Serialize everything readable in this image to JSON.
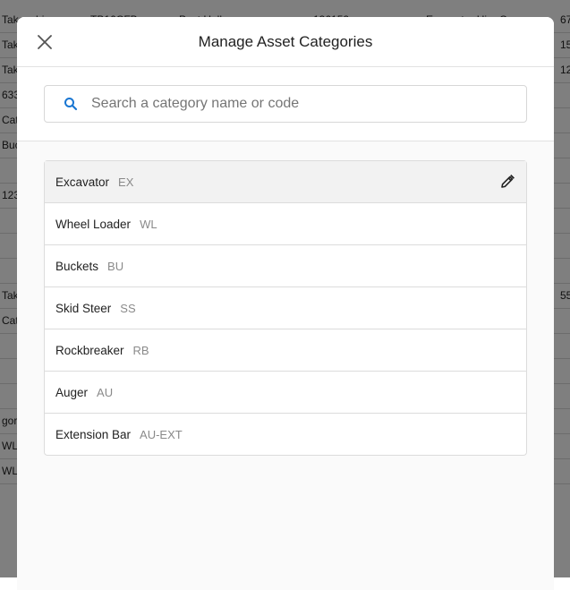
{
  "background": {
    "rows": [
      {
        "cells": [
          "Takeuchi",
          "TB16CFB",
          "Post Holl",
          "136152",
          "Excavator Hire Co",
          "67"
        ]
      },
      {
        "cells": [
          "Tak",
          "",
          "",
          "",
          "",
          "15"
        ]
      },
      {
        "cells": [
          "Tak",
          "",
          "",
          "",
          "",
          "12"
        ]
      },
      {
        "cells": [
          "633",
          "",
          "",
          "",
          "",
          ""
        ]
      },
      {
        "cells": [
          "Cat",
          "",
          "",
          "",
          "",
          ""
        ]
      },
      {
        "cells": [
          "Buc",
          "",
          "",
          "",
          "",
          ""
        ]
      },
      {
        "cells": [
          "",
          "",
          "",
          "",
          "",
          ""
        ]
      },
      {
        "cells": [
          "123",
          "",
          "",
          "",
          "",
          ""
        ]
      },
      {
        "cells": [
          "",
          "",
          "",
          "",
          "",
          ""
        ]
      },
      {
        "cells": [
          "",
          "",
          "",
          "",
          "",
          ""
        ]
      },
      {
        "cells": [
          "",
          "",
          "",
          "",
          "",
          ""
        ]
      },
      {
        "cells": [
          "Tak",
          "",
          "",
          "",
          "",
          "55"
        ]
      },
      {
        "cells": [
          "Cat",
          "",
          "",
          "",
          "",
          ""
        ]
      },
      {
        "cells": [
          "",
          "",
          "",
          "",
          "",
          ""
        ]
      },
      {
        "cells": [
          "",
          "",
          "",
          "",
          "",
          ""
        ]
      },
      {
        "cells": [
          "",
          "",
          "",
          "",
          "",
          ""
        ]
      },
      {
        "cells": [
          "gor",
          "",
          "",
          "",
          "",
          ""
        ]
      },
      {
        "cells": [
          "WL,",
          "",
          "",
          "",
          "",
          ""
        ]
      },
      {
        "cells": [
          "WL",
          "",
          "",
          "",
          "",
          ""
        ]
      }
    ]
  },
  "modal": {
    "title": "Manage Asset Categories",
    "close_icon": "close-icon",
    "search": {
      "placeholder": "Search a category name or code",
      "value": "",
      "icon": "search-icon",
      "icon_color": "#1976d2"
    },
    "categories": [
      {
        "name": "Excavator",
        "code": "EX",
        "selected": true
      },
      {
        "name": "Wheel Loader",
        "code": "WL",
        "selected": false
      },
      {
        "name": "Buckets",
        "code": "BU",
        "selected": false
      },
      {
        "name": "Skid Steer",
        "code": "SS",
        "selected": false
      },
      {
        "name": "Rockbreaker",
        "code": "RB",
        "selected": false
      },
      {
        "name": "Auger",
        "code": "AU",
        "selected": false
      },
      {
        "name": "Extension Bar",
        "code": "AU-EXT",
        "selected": false
      }
    ],
    "edit_icon": "pencil-icon"
  }
}
